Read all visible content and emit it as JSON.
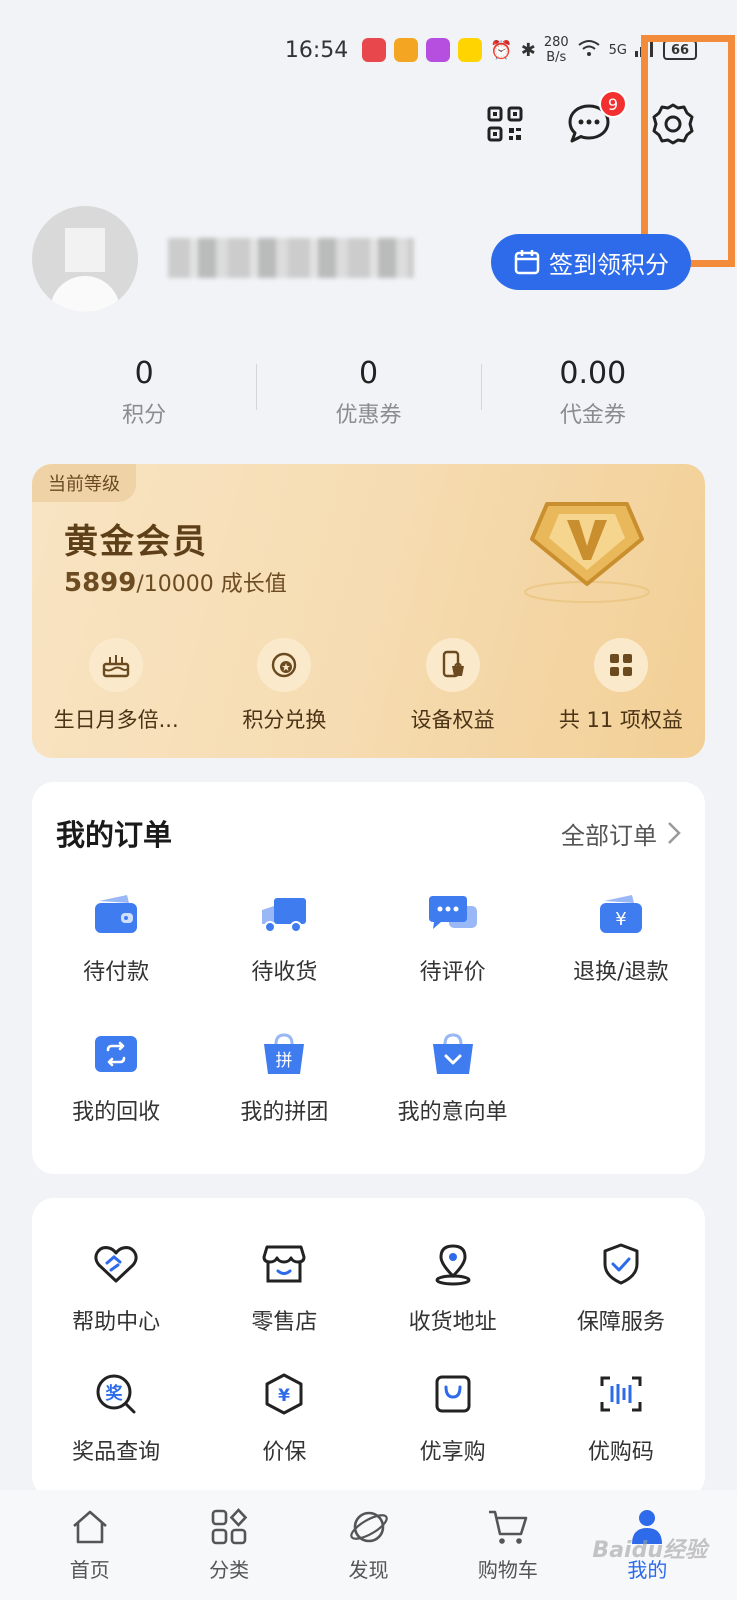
{
  "status_bar": {
    "time": "16:54",
    "net_speed_value": "280",
    "net_speed_unit": "B/s",
    "signal": "5G",
    "battery": "66"
  },
  "header": {
    "message_badge": "9"
  },
  "profile": {
    "signin_label": "签到领积分"
  },
  "stats": [
    {
      "value": "0",
      "label": "积分"
    },
    {
      "value": "0",
      "label": "优惠券"
    },
    {
      "value": "0.00",
      "label": "代金券"
    }
  ],
  "membership": {
    "tag": "当前等级",
    "level": "黄金会员",
    "growth_current": "5899",
    "growth_total": "/10000 成长值",
    "perks": [
      {
        "label": "生日月多倍...",
        "icon": "cake-icon"
      },
      {
        "label": "积分兑换",
        "icon": "points-exchange-icon"
      },
      {
        "label": "设备权益",
        "icon": "device-benefit-icon"
      },
      {
        "label": "共 11 项权益",
        "icon": "grid-icon"
      }
    ]
  },
  "orders": {
    "title": "我的订单",
    "all_label": "全部订单",
    "items": [
      {
        "label": "待付款",
        "icon": "wallet-icon"
      },
      {
        "label": "待收货",
        "icon": "truck-icon"
      },
      {
        "label": "待评价",
        "icon": "comment-icon"
      },
      {
        "label": "退换/退款",
        "icon": "refund-icon"
      },
      {
        "label": "我的回收",
        "icon": "recycle-icon"
      },
      {
        "label": "我的拼团",
        "icon": "group-buy-icon"
      },
      {
        "label": "我的意向单",
        "icon": "intent-bag-icon"
      }
    ],
    "group_buy_glyph": "拼",
    "refund_glyph": "¥"
  },
  "services": {
    "items": [
      {
        "label": "帮助中心",
        "icon": "help-heart-icon"
      },
      {
        "label": "零售店",
        "icon": "store-icon"
      },
      {
        "label": "收货地址",
        "icon": "location-icon"
      },
      {
        "label": "保障服务",
        "icon": "shield-check-icon"
      },
      {
        "label": "奖品查询",
        "icon": "prize-search-icon"
      },
      {
        "label": "价保",
        "icon": "price-protect-icon"
      },
      {
        "label": "优享购",
        "icon": "shopping-bag-icon"
      },
      {
        "label": "优购码",
        "icon": "barcode-icon"
      }
    ],
    "prize_glyph": "奖",
    "price_glyph": "¥"
  },
  "bottom_nav": [
    {
      "label": "首页",
      "icon": "home-icon"
    },
    {
      "label": "分类",
      "icon": "category-icon"
    },
    {
      "label": "发现",
      "icon": "discover-icon"
    },
    {
      "label": "购物车",
      "icon": "cart-icon"
    },
    {
      "label": "我的",
      "icon": "profile-icon",
      "active": true
    }
  ],
  "colors": {
    "accent": "#2e6bea",
    "badge_red": "#f23030",
    "highlight_orange": "#f28c3a",
    "gold": "#f2cf95"
  }
}
